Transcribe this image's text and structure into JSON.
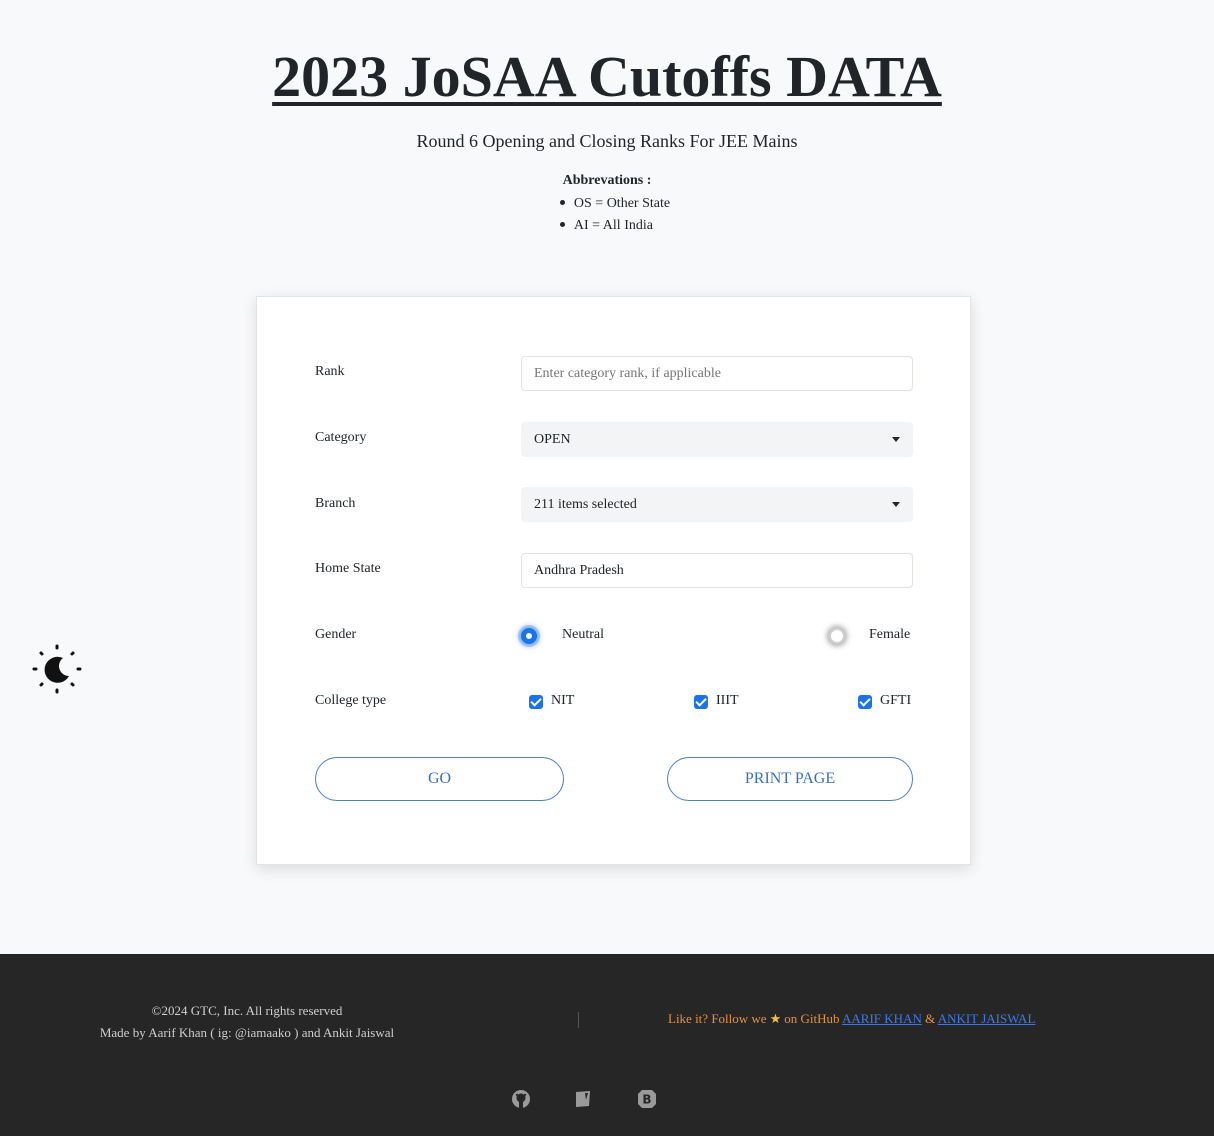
{
  "header": {
    "title": "2023 JoSAA Cutoffs DATA",
    "subtitle": "Round 6 Opening and Closing Ranks For JEE Mains",
    "abbreviations_title": "Abbrevations :",
    "abbreviations": [
      "OS = Other State",
      "AI = All India"
    ]
  },
  "theme_toggle": {
    "icon": "moon-sun-icon"
  },
  "form": {
    "rank_label": "Rank",
    "rank_placeholder": "Enter category rank, if applicable",
    "category_label": "Category",
    "category_value": "OPEN",
    "branch_label": "Branch",
    "branch_value": "211 items selected",
    "home_state_label": "Home State",
    "home_state_value": "Andhra Pradesh",
    "gender_label": "Gender",
    "gender_options": [
      {
        "label": "Neutral",
        "selected": true
      },
      {
        "label": "Female",
        "selected": false
      }
    ],
    "college_type_label": "College type",
    "college_types": [
      {
        "label": "NIT",
        "checked": true
      },
      {
        "label": "IIIT",
        "checked": true
      },
      {
        "label": "GFTI",
        "checked": true
      }
    ],
    "go_label": "GO",
    "print_label": "PRINT PAGE"
  },
  "footer": {
    "copyright": "©2024 GTC, Inc. All rights reserved",
    "made_by": "Made by Aarif Khan ( ig: @iamaako ) and Ankit Jaiswal",
    "like_text_1": "Like it? Follow we",
    "like_text_2": "on GitHub",
    "author1": "AARIF KHAN",
    "amp": "&",
    "author2": "ANKIT JAISWAL",
    "icons": [
      "github-icon",
      "notion-icon",
      "bootstrap-icon"
    ]
  },
  "colors": {
    "accent": "#1a73e8",
    "footer_bg": "#262626",
    "footer_link": "#3d7ae8",
    "footer_text_orange": "#e8913a"
  }
}
